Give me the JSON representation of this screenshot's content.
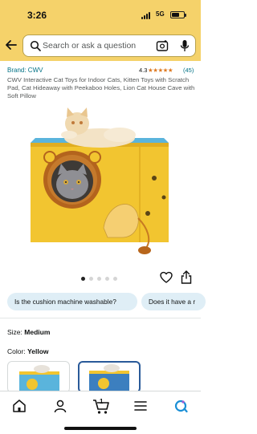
{
  "status_bar": {
    "time": "3:26",
    "network": "5G",
    "battery_level": 0.62
  },
  "search": {
    "placeholder": "Search or ask a question",
    "icons": [
      "back-arrow-icon",
      "search-icon",
      "camera-icon",
      "microphone-icon"
    ]
  },
  "product": {
    "brand": "Brand: CWV",
    "rating": "4.3",
    "stars": "★★★★★",
    "star_fraction": 0.86,
    "review_count": "(45)",
    "title": "CWV Interactive Cat Toys for Indoor Cats, Kitten Toys with Scratch Pad,   Cat Hideaway with Peekaboo Holes, Lion Cat House Cave with Soft Pillow"
  },
  "gallery": {
    "dot_count": 5,
    "active_index": 0,
    "actions": [
      "heart-icon",
      "share-icon"
    ]
  },
  "questions": [
    "Is the cushion machine washable?",
    "Does it have a r"
  ],
  "variations": {
    "size_label": "Size:",
    "size_value": "Medium",
    "color_label": "Color:",
    "color_value": "Yellow",
    "selected_swatch": 1
  },
  "nav": {
    "items": [
      "home-icon",
      "account-icon",
      "cart-icon",
      "menu-icon",
      "ai-assistant-icon"
    ],
    "cart_count": "1"
  },
  "colors": {
    "header": "#f5d26a",
    "link": "#007185",
    "star": "#de7921",
    "chip": "#dfeef6",
    "box_yellow": "#f2c530",
    "box_lid": "#5ab4dc"
  }
}
